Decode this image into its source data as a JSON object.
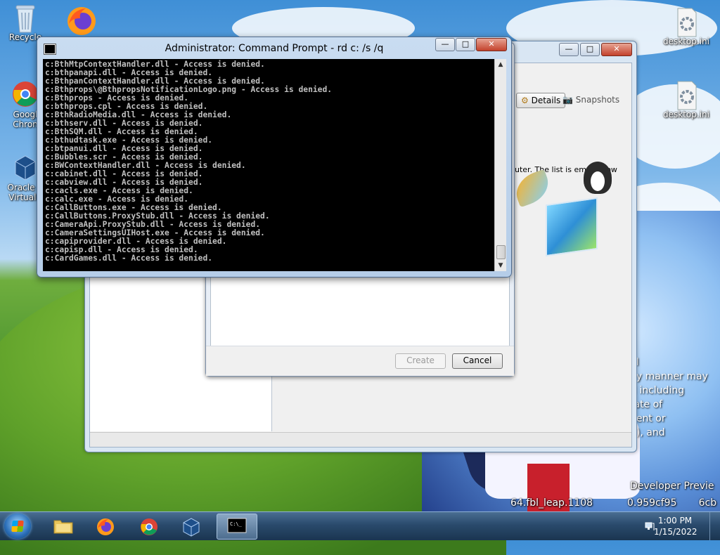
{
  "desktop": {
    "icons_left": [
      {
        "label": "Recycle",
        "icon": "recycle-bin-icon"
      },
      {
        "label": "Google Chrome",
        "label_line1": "Googl",
        "label_line2": "Chron",
        "icon": "chrome-icon"
      },
      {
        "label": "Oracle VirtualBox",
        "label_line1": "Oracle V",
        "label_line2": "VirtualB",
        "icon": "virtualbox-icon"
      }
    ],
    "firefox_icon": "firefox-icon",
    "icons_right": [
      {
        "label": "desktop.ini",
        "icon": "settings-file-icon"
      },
      {
        "label": "desktop.ini",
        "icon": "settings-file-icon"
      }
    ],
    "legal_lines": [
      "al",
      "ny manner may",
      "d including",
      "tate of",
      "nent or",
      "n), and"
    ],
    "watermark_line1": "Developer Previe",
    "watermark_line2": "64.fbl_leap.1108           0.959cf95       6cb"
  },
  "vbox_window": {
    "details_label": "Details",
    "snapshots_label": "Snapshots",
    "welcome_text": "uter. The list is empty now"
  },
  "create_dialog": {
    "create_label": "Create",
    "cancel_label": "Cancel"
  },
  "cmd_window": {
    "title": "Administrator: Command Prompt - rd  c: /s /q",
    "lines": [
      "c:BthMtpContextHandler.dll - Access is denied.",
      "c:bthpanapi.dll - Access is denied.",
      "c:BthpanContextHandler.dll - Access is denied.",
      "c:Bthprops\\@BthpropsNotificationLogo.png - Access is denied.",
      "c:Bthprops - Access is denied.",
      "c:bthprops.cpl - Access is denied.",
      "c:BthRadioMedia.dll - Access is denied.",
      "c:bthserv.dll - Access is denied.",
      "c:BthSQM.dll - Access is denied.",
      "c:bthudtask.exe - Access is denied.",
      "c:btpanui.dll - Access is denied.",
      "c:Bubbles.scr - Access is denied.",
      "c:BWContextHandler.dll - Access is denied.",
      "c:cabinet.dll - Access is denied.",
      "c:cabview.dll - Access is denied.",
      "c:cacls.exe - Access is denied.",
      "c:calc.exe - Access is denied.",
      "c:CallButtons.exe - Access is denied.",
      "c:CallButtons.ProxyStub.dll - Access is denied.",
      "c:CameraApi.ProxyStub.dll - Access is denied.",
      "c:CameraSettingsUIHost.exe - Access is denied.",
      "c:capiprovider.dll - Access is denied.",
      "c:capisp.dll - Access is denied.",
      "c:CardGames.dll - Access is denied."
    ],
    "minimize_glyph": "—",
    "maximize_glyph": "□",
    "close_glyph": "✕",
    "scroll_up_glyph": "▲",
    "scroll_down_glyph": "▼"
  },
  "taskbar": {
    "apps": [
      {
        "name": "Windows Explorer",
        "icon": "folder-icon"
      },
      {
        "name": "Firefox",
        "icon": "firefox-icon"
      },
      {
        "name": "Google Chrome",
        "icon": "chrome-icon"
      },
      {
        "name": "Oracle VirtualBox",
        "icon": "virtualbox-icon"
      },
      {
        "name": "Command Prompt",
        "icon": "cmd-icon",
        "active": true
      }
    ],
    "time": "1:00 PM",
    "date": "1/15/2022",
    "tray_icon": "network-icon"
  },
  "colors": {
    "console_bg": "#000000",
    "console_text": "#c0c0c0",
    "taskbar": "#2a4a6c"
  }
}
